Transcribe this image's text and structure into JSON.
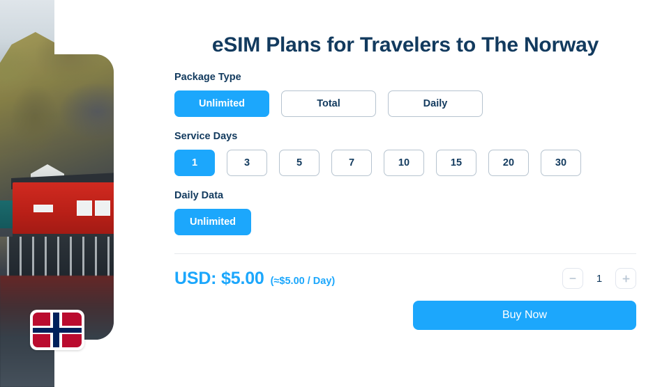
{
  "page": {
    "title": "eSIM Plans for Travelers to The Norway",
    "background_color": "#ffffff",
    "accent_color": "#1CA7FC",
    "heading_color": "#123a5e",
    "border_color": "#b6c3cf"
  },
  "hero": {
    "alt": "Norwegian fjord village with red rorbu cabins",
    "flag_icon": "norway-flag-icon",
    "flag_colors": {
      "red": "#ba0c2f",
      "white": "#ffffff",
      "blue": "#00205b"
    }
  },
  "package_type": {
    "label": "Package Type",
    "options": [
      {
        "label": "Unlimited",
        "selected": true
      },
      {
        "label": "Total",
        "selected": false
      },
      {
        "label": "Daily",
        "selected": false
      }
    ]
  },
  "service_days": {
    "label": "Service Days",
    "options": [
      {
        "label": "1",
        "selected": true
      },
      {
        "label": "3",
        "selected": false
      },
      {
        "label": "5",
        "selected": false
      },
      {
        "label": "7",
        "selected": false
      },
      {
        "label": "10",
        "selected": false
      },
      {
        "label": "15",
        "selected": false
      },
      {
        "label": "20",
        "selected": false
      },
      {
        "label": "30",
        "selected": false
      }
    ]
  },
  "daily_data": {
    "label": "Daily Data",
    "options": [
      {
        "label": "Unlimited",
        "selected": true
      }
    ]
  },
  "price": {
    "main": "USD: $5.00",
    "per_day": "(≈$5.00 / Day)"
  },
  "quantity": {
    "value": "1",
    "decrement_icon": "minus-icon",
    "increment_icon": "plus-icon"
  },
  "actions": {
    "buy_now_label": "Buy Now"
  }
}
